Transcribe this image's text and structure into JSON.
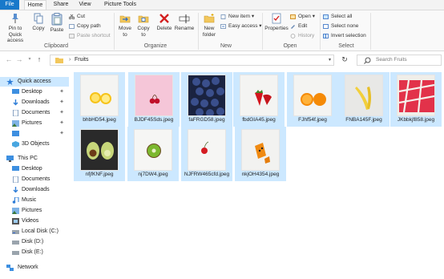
{
  "ribbon_tabs": [
    "File",
    "Home",
    "Share",
    "View",
    "Picture Tools"
  ],
  "clipboard": {
    "pin_label": "Pin to Quick access",
    "copy_label": "Copy",
    "paste_label": "Paste",
    "cut_label": "Cut",
    "copy_path_label": "Copy path",
    "paste_shortcut_label": "Paste shortcut",
    "group_label": "Clipboard"
  },
  "organize": {
    "move_to_label": "Move to",
    "copy_to_label": "Copy to",
    "delete_label": "Delete",
    "rename_label": "Rename",
    "group_label": "Organize"
  },
  "new_group": {
    "new_folder_label": "New folder",
    "new_item_label": "New item",
    "easy_access_label": "Easy access",
    "group_label": "New"
  },
  "open_group": {
    "properties_label": "Properties",
    "open_label": "Open",
    "edit_label": "Edit",
    "history_label": "History",
    "group_label": "Open"
  },
  "select_group": {
    "select_all_label": "Select all",
    "select_none_label": "Select none",
    "invert_selection_label": "Invert selection",
    "group_label": "Select"
  },
  "address": {
    "path": "Fruits",
    "search_placeholder": "Search Fruits"
  },
  "nav_pane": {
    "items": [
      {
        "label": "Quick access"
      },
      {
        "label": "Desktop"
      },
      {
        "label": "Downloads"
      },
      {
        "label": "Documents"
      },
      {
        "label": "Pictures"
      },
      {
        "label": ""
      },
      {
        "label": "3D Objects"
      },
      {
        "label": "This PC"
      },
      {
        "label": "Desktop"
      },
      {
        "label": "Documents"
      },
      {
        "label": "Downloads"
      },
      {
        "label": "Music"
      },
      {
        "label": "Pictures"
      },
      {
        "label": "Videos"
      },
      {
        "label": "Local Disk (C:)"
      },
      {
        "label": "Disk (D:)"
      },
      {
        "label": "Disk (E:)"
      },
      {
        "label": "Network"
      }
    ]
  },
  "files": [
    {
      "name": "bhbHD54.jpeg"
    },
    {
      "name": "BJDF45Sds.jpeg"
    },
    {
      "name": "faFRGD58.jpeg"
    },
    {
      "name": "fbdGIA45.jpeg"
    },
    {
      "name": "FJhf54f.jpeg"
    },
    {
      "name": "FNBA145F.jpeg"
    },
    {
      "name": "JKbbkjf858.jpeg"
    },
    {
      "name": "nfjfKNF.jpeg"
    },
    {
      "name": "nj7DW4.jpeg"
    },
    {
      "name": "NJFRW465cfd.jpeg"
    },
    {
      "name": "nkjOH4354.jpeg"
    }
  ],
  "colors": {
    "selection": "#cce8ff",
    "file_tab": "#1979ca"
  }
}
